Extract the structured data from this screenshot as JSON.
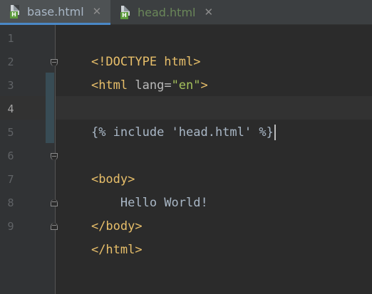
{
  "tabs": [
    {
      "label": "base.html",
      "active": true,
      "icon": "html-file-icon"
    },
    {
      "label": "head.html",
      "active": false,
      "icon": "html-file-icon"
    }
  ],
  "close_glyph": "✕",
  "file_badge": "H",
  "current_line": 4,
  "line_numbers": [
    "1",
    "2",
    "3",
    "4",
    "5",
    "6",
    "7",
    "8",
    "9"
  ],
  "code": {
    "l1": {
      "tag": "<!DOCTYPE html>"
    },
    "l2": {
      "open": "<html ",
      "attr": "lang=",
      "value": "\"en\"",
      "close": ">"
    },
    "l3": {
      "text": ""
    },
    "l4": {
      "text": "{% include 'head.html' %}"
    },
    "l5": {
      "text": ""
    },
    "l6": {
      "tag": "<body>"
    },
    "l7": {
      "text": "    Hello World!"
    },
    "l8": {
      "tag": "</body>"
    },
    "l9": {
      "tag": "</html>"
    }
  },
  "colors": {
    "background": "#2b2b2b",
    "gutter": "#313335",
    "tag": "#e8bf6a",
    "string": "#a5c25c",
    "text": "#a9b7c6",
    "active_tab_underline": "#4a88c7"
  }
}
